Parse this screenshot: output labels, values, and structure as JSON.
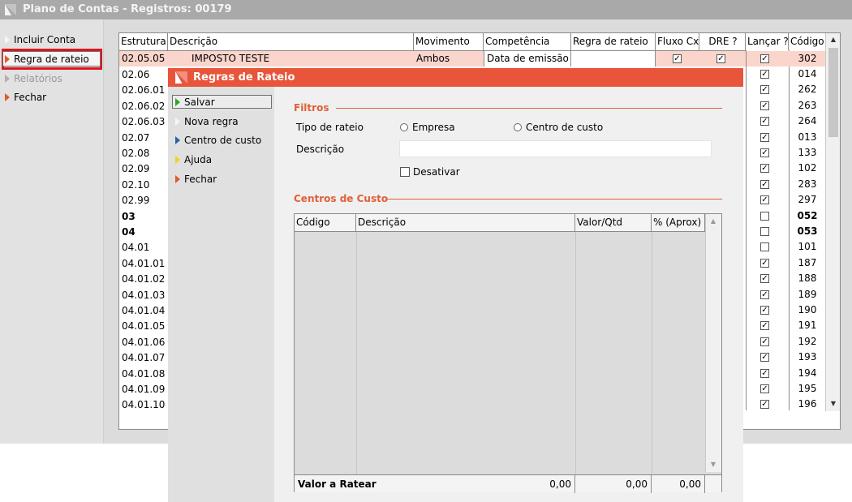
{
  "window": {
    "title": "Plano de Contas - Registros: 00179"
  },
  "sidebar": {
    "items": [
      {
        "label": "Incluir Conta"
      },
      {
        "label": "Regra de rateio"
      },
      {
        "label": "Relatórios"
      },
      {
        "label": "Fechar"
      }
    ]
  },
  "grid": {
    "columns": [
      "Estrutura",
      "Descrição",
      "Movimento",
      "Competência",
      "Regra de rateio",
      "Fluxo Cx",
      "DRE ?",
      "Lançar ?",
      "Código"
    ],
    "selected_row": {
      "estrutura": "02.05.05",
      "descricao": "IMPOSTO TESTE",
      "movimento": "Ambos",
      "competencia": "Data de emissão",
      "regra": "",
      "fluxo": true,
      "dre": true,
      "lancar": true,
      "codigo": "302"
    },
    "rows": [
      {
        "estrutura": "02.06",
        "lancar": true,
        "codigo": "014",
        "bold": false
      },
      {
        "estrutura": "02.06.01",
        "lancar": true,
        "codigo": "262",
        "bold": false
      },
      {
        "estrutura": "02.06.02",
        "lancar": true,
        "codigo": "263",
        "bold": false
      },
      {
        "estrutura": "02.06.03",
        "lancar": true,
        "codigo": "264",
        "bold": false
      },
      {
        "estrutura": "02.07",
        "lancar": true,
        "codigo": "013",
        "bold": false
      },
      {
        "estrutura": "02.08",
        "lancar": true,
        "codigo": "133",
        "bold": false
      },
      {
        "estrutura": "02.09",
        "lancar": true,
        "codigo": "102",
        "bold": false
      },
      {
        "estrutura": "02.10",
        "lancar": true,
        "codigo": "283",
        "bold": false
      },
      {
        "estrutura": "02.99",
        "lancar": true,
        "codigo": "297",
        "bold": false
      },
      {
        "estrutura": "03",
        "lancar": false,
        "codigo": "052",
        "bold": true
      },
      {
        "estrutura": "04",
        "lancar": false,
        "codigo": "053",
        "bold": true
      },
      {
        "estrutura": "04.01",
        "lancar": false,
        "codigo": "101",
        "bold": false
      },
      {
        "estrutura": "04.01.01",
        "lancar": true,
        "codigo": "187",
        "bold": false
      },
      {
        "estrutura": "04.01.02",
        "lancar": true,
        "codigo": "188",
        "bold": false
      },
      {
        "estrutura": "04.01.03",
        "lancar": true,
        "codigo": "189",
        "bold": false
      },
      {
        "estrutura": "04.01.04",
        "lancar": true,
        "codigo": "190",
        "bold": false
      },
      {
        "estrutura": "04.01.05",
        "lancar": true,
        "codigo": "191",
        "bold": false
      },
      {
        "estrutura": "04.01.06",
        "lancar": true,
        "codigo": "192",
        "bold": false
      },
      {
        "estrutura": "04.01.07",
        "lancar": true,
        "codigo": "193",
        "bold": false
      },
      {
        "estrutura": "04.01.08",
        "lancar": true,
        "codigo": "194",
        "bold": false
      },
      {
        "estrutura": "04.01.09",
        "lancar": true,
        "codigo": "195",
        "bold": false
      },
      {
        "estrutura": "04.01.10",
        "lancar": true,
        "codigo": "196",
        "bold": false
      }
    ]
  },
  "dialog": {
    "title": "Regras de Rateio",
    "menu": [
      {
        "label": "Salvar",
        "icon": "green-triangle"
      },
      {
        "label": "Nova regra",
        "icon": "white-triangle"
      },
      {
        "label": "Centro de custo",
        "icon": "blue-triangle"
      },
      {
        "label": "Ajuda",
        "icon": "yellow-triangle"
      },
      {
        "label": "Fechar",
        "icon": "orange-triangle"
      }
    ],
    "filtros": {
      "title": "Filtros",
      "tipo_label": "Tipo de rateio",
      "radio_empresa": "Empresa",
      "radio_centro": "Centro de custo",
      "descricao_label": "Descrição",
      "descricao_value": "",
      "desativar_label": "Desativar"
    },
    "centros": {
      "title": "Centros de Custo",
      "columns": [
        "Código",
        "Descrição",
        "Valor/Qtd",
        "% (Aprox)"
      ],
      "footer_label": "Valor a Ratear",
      "footer_values": [
        "0,00",
        "0,00",
        "0,00"
      ]
    }
  },
  "colors": {
    "accent": "#e8553a",
    "selected_row": "#f9d5cc",
    "highlight": "#e0141e"
  }
}
